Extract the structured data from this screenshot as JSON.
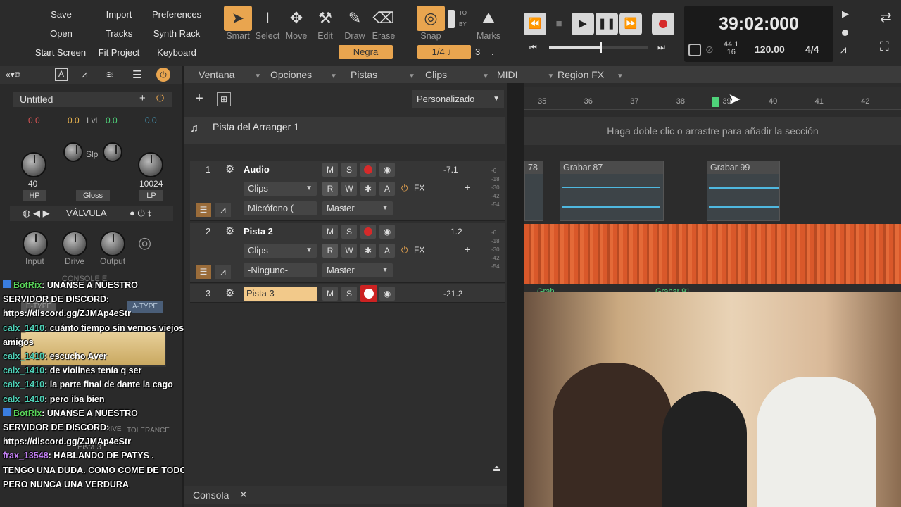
{
  "top_menu": {
    "save": "Save",
    "import": "Import",
    "preferences": "Preferences",
    "open": "Open",
    "tracks": "Tracks",
    "synth_rack": "Synth Rack",
    "start_screen": "Start Screen",
    "fit_project": "Fit Project",
    "keyboard": "Keyboard"
  },
  "tools": {
    "smart": "Smart",
    "select": "Select",
    "move": "Move",
    "edit": "Edit",
    "draw": "Draw",
    "erase": "Erase",
    "snap": "Snap",
    "marks": "Marks",
    "negra": "Negra",
    "snap_value": "1/4",
    "snap_note": "♩",
    "snap_count": "3",
    "snap_dot": ".",
    "to": "TO",
    "by": "BY"
  },
  "transport": {
    "time": "39:02:000",
    "sample_rate_top": "44.1",
    "sample_rate_bottom": "16",
    "tempo": "120.00",
    "meter": "4/4"
  },
  "inspector": {
    "title": "Untitled",
    "vals": [
      "0.0",
      "0.0",
      "Lvl",
      "0.0",
      "0.0"
    ],
    "slp": "Slp",
    "left_knob_val": "40",
    "right_knob_val": "10024",
    "hp": "HP",
    "gloss": "Gloss",
    "lp": "LP",
    "fx_name": "VÁLVULA",
    "input": "Input",
    "drive": "Drive",
    "output": "Output",
    "console": "CONSOLE E",
    "a_type": "A-TYPE",
    "e_type": "E-TYPE",
    "drive2": "DRIVE",
    "tolerance": "TOLERANCE",
    "pista3": "Pista 3"
  },
  "chat": [
    {
      "user": "BotRix",
      "text": ": UNANSE A NUESTRO",
      "cls": "user-bot",
      "badge": true
    },
    {
      "user": "",
      "text": "SERVIDOR DE DISCORD:",
      "cls": "",
      "badge": false
    },
    {
      "user": "",
      "text": "https://discord.gg/ZJMAp4eStr",
      "cls": "",
      "badge": false
    },
    {
      "user": "calx_1410",
      "text": ": cuánto tiempo sin vernos viejos",
      "cls": "user-green",
      "badge": false
    },
    {
      "user": "",
      "text": "amigos",
      "cls": "",
      "badge": false
    },
    {
      "user": "calx_1410",
      "text": ": escucho Aver",
      "cls": "user-green",
      "badge": false
    },
    {
      "user": "calx_1410",
      "text": ": de violines tenía q ser",
      "cls": "user-green",
      "badge": false
    },
    {
      "user": "calx_1410",
      "text": ": la parte final de dante la cago",
      "cls": "user-green",
      "badge": false
    },
    {
      "user": "calx_1410",
      "text": ": pero iba bien",
      "cls": "user-green",
      "badge": false
    },
    {
      "user": "BotRix",
      "text": ": UNANSE A NUESTRO",
      "cls": "user-bot",
      "badge": true
    },
    {
      "user": "",
      "text": "SERVIDOR DE DISCORD:",
      "cls": "",
      "badge": false
    },
    {
      "user": "",
      "text": "https://discord.gg/ZJMAp4eStr",
      "cls": "",
      "badge": false
    },
    {
      "user": "frax_13548",
      "text": ": HABLANDO DE PATYS .",
      "cls": "user-pink",
      "badge": false
    },
    {
      "user": "",
      "text": "TENGO UNA DUDA. COMO COME DE TODO",
      "cls": "",
      "badge": false
    },
    {
      "user": "",
      "text": "PERO NUNCA UNA VERDURA",
      "cls": "",
      "badge": false
    }
  ],
  "menubar2": {
    "ventana": "Ventana",
    "opciones": "Opciones",
    "pistas": "Pistas",
    "clips": "Clips",
    "midi": "MIDI",
    "region_fx": "Region FX"
  },
  "arranger": {
    "preset": "Personalizado",
    "arranger_track": "Pista del Arranger 1",
    "hint": "Haga doble clic o arrastre para añadir la sección",
    "ruler": [
      "35",
      "36",
      "37",
      "38",
      "39",
      "40",
      "41",
      "42"
    ]
  },
  "tracks": [
    {
      "num": "1",
      "name": "Audio",
      "vol": "-7.1",
      "mode": "Clips",
      "input": "Micrófono (",
      "output": "Master"
    },
    {
      "num": "2",
      "name": "Pista 2",
      "vol": "1.2",
      "mode": "Clips",
      "input": "-Ninguno-",
      "output": "Master"
    },
    {
      "num": "3",
      "name": "Pista 3",
      "vol": "-21.2"
    }
  ],
  "track_buttons": {
    "m": "M",
    "s": "S",
    "r": "R",
    "w": "W",
    "a": "A",
    "fx": "FX"
  },
  "meter_labels": [
    "-6",
    "-18",
    "-30",
    "-42",
    "-54"
  ],
  "clips": {
    "c78": "78",
    "c87": "Grabar 87",
    "c99": "Grabar 99",
    "c91": "Grabar 91",
    "cgrab": "Grab"
  },
  "bottom": {
    "console": "Consola"
  }
}
